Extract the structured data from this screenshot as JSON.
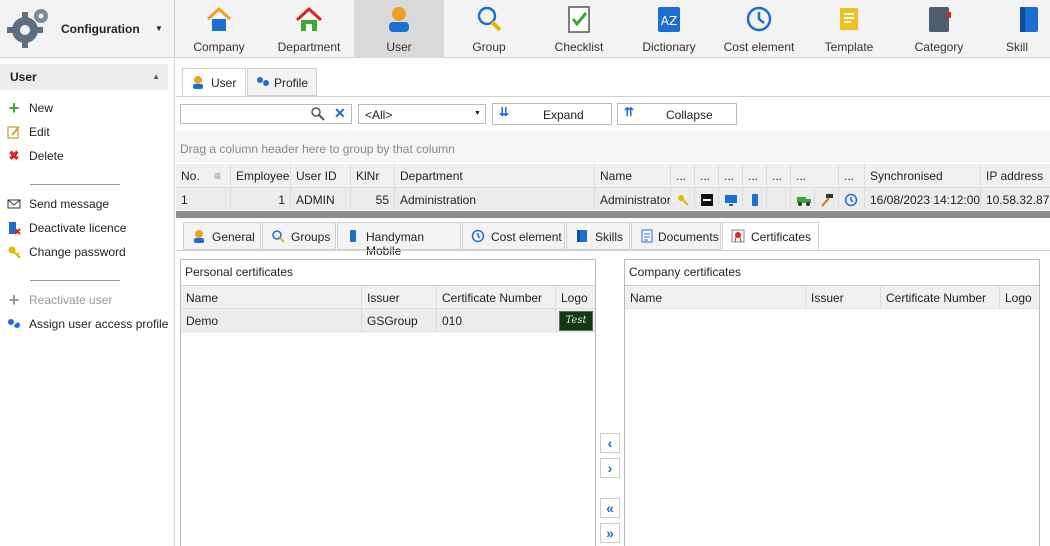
{
  "config": {
    "title": "Configuration"
  },
  "nav": [
    {
      "label": "Company",
      "icon": "house-icon"
    },
    {
      "label": "Department",
      "icon": "department-icon"
    },
    {
      "label": "User",
      "icon": "user-icon"
    },
    {
      "label": "Group",
      "icon": "group-icon"
    },
    {
      "label": "Checklist",
      "icon": "checklist-icon"
    },
    {
      "label": "Dictionary",
      "icon": "dictionary-icon"
    },
    {
      "label": "Cost element",
      "icon": "clock-icon"
    },
    {
      "label": "Template",
      "icon": "template-icon"
    },
    {
      "label": "Category",
      "icon": "category-icon"
    },
    {
      "label": "Skill",
      "icon": "skill-icon"
    }
  ],
  "sidebar": {
    "title": "User",
    "items": [
      {
        "label": "New"
      },
      {
        "label": "Edit"
      },
      {
        "label": "Delete"
      },
      {
        "label": "Send message"
      },
      {
        "label": "Deactivate licence"
      },
      {
        "label": "Change password"
      },
      {
        "label": "Reactivate user"
      },
      {
        "label": "Assign user access profile"
      }
    ]
  },
  "tabs_top": [
    {
      "label": "User"
    },
    {
      "label": "Profile"
    }
  ],
  "filter": {
    "search_value": "",
    "select_value": "<All>",
    "expand": "Expand",
    "collapse": "Collapse"
  },
  "group_hint": "Drag a column header here to group by that column",
  "users_grid": {
    "headers": [
      "No.",
      "Employee",
      "User ID",
      "KlNr",
      "Department",
      "Name",
      "...",
      "...",
      "...",
      "...",
      "...",
      "...",
      "...",
      "Synchronised",
      "IP address"
    ],
    "row": {
      "no": "1",
      "employee": "1",
      "user_id": "ADMIN",
      "klnr": "55",
      "department": "Administration",
      "name": "Administrator",
      "synchronised": "16/08/2023 14:12:00",
      "ip": "10.58.32.87"
    }
  },
  "tabs_detail": [
    {
      "label": "General"
    },
    {
      "label": "Groups"
    },
    {
      "label": "Handyman Mobile"
    },
    {
      "label": "Cost element"
    },
    {
      "label": "Skills"
    },
    {
      "label": "Documents"
    },
    {
      "label": "Certificates"
    }
  ],
  "personal": {
    "title": "Personal certificates",
    "headers": [
      "Name",
      "Issuer",
      "Certificate Number",
      "Logo"
    ],
    "rows": [
      {
        "name": "Demo",
        "issuer": "GSGroup",
        "number": "010",
        "logo": "Test"
      }
    ]
  },
  "company": {
    "title": "Company certificates",
    "headers": [
      "Name",
      "Issuer",
      "Certificate Number",
      "Logo"
    ]
  }
}
